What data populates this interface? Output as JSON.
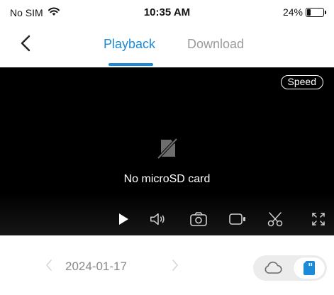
{
  "status_bar": {
    "carrier": "No SIM",
    "time": "10:35 AM",
    "battery_text": "24%",
    "battery_level": 0.24,
    "icons": [
      "wifi-icon",
      "battery-icon"
    ]
  },
  "nav": {
    "back_icon": "chevron-left-icon",
    "tabs": [
      {
        "label": "Playback",
        "active": true
      },
      {
        "label": "Download",
        "active": false
      }
    ],
    "active_color": "#1c8ad6",
    "inactive_color": "#9a9a9a"
  },
  "player": {
    "speed_label": "Speed",
    "message": "No microSD card",
    "message_icon": "sd-card-off-icon",
    "controls": [
      "play-icon",
      "volume-icon",
      "camera-icon",
      "record-icon",
      "scissors-icon",
      "fullscreen-icon"
    ]
  },
  "date_bar": {
    "date": "2024-01-17",
    "prev_icon": "chevron-left-icon",
    "next_icon": "chevron-right-icon",
    "storage_options": [
      {
        "name": "cloud-icon",
        "selected": false
      },
      {
        "name": "sd-card-icon",
        "selected": true
      }
    ],
    "selected_color": "#1c8ad6"
  }
}
